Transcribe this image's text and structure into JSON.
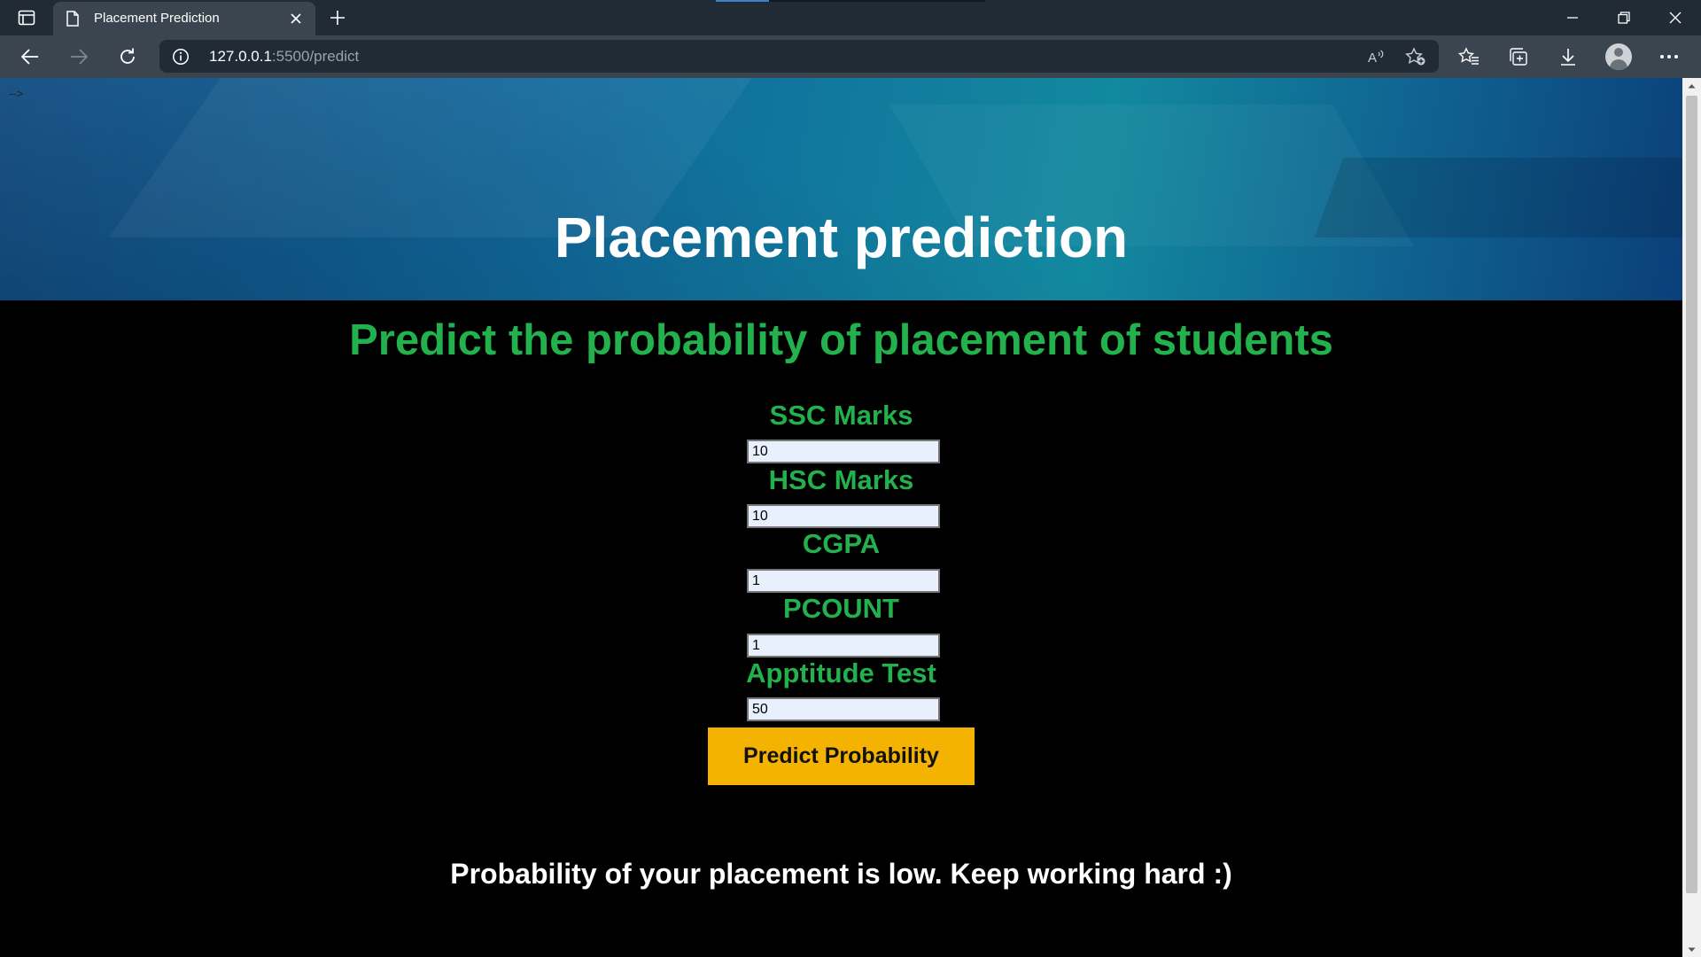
{
  "browser": {
    "tab": {
      "title": "Placement Prediction"
    },
    "address": {
      "host": "127.0.0.1",
      "path": ":5500/predict"
    }
  },
  "page": {
    "comment_leak": "-->",
    "title": "Placement prediction",
    "subtitle": "Predict the probability of placement of students",
    "fields": [
      {
        "label": "SSC Marks",
        "value": "10"
      },
      {
        "label": "HSC Marks",
        "value": "10"
      },
      {
        "label": "CGPA",
        "value": "1"
      },
      {
        "label": "PCOUNT",
        "value": "1"
      },
      {
        "label": "Apptitude Test",
        "value": "50"
      }
    ],
    "submit_label": "Predict Probability",
    "result": "Probability of your placement is low. Keep working hard :)"
  },
  "colors": {
    "accent_green": "#22b14c",
    "button_yellow": "#f5b301",
    "chrome_dark": "#202b36",
    "chrome_mid": "#3a4550"
  }
}
